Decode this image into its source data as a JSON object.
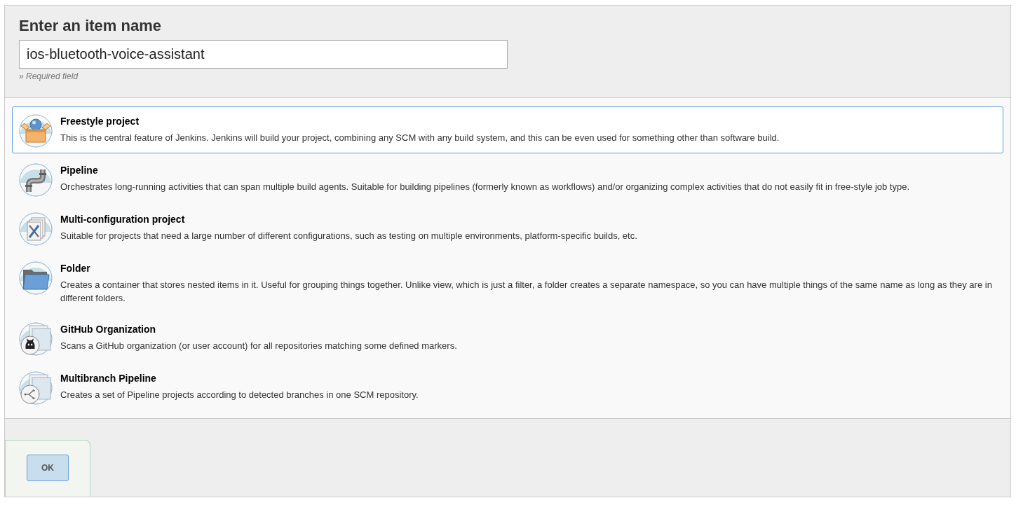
{
  "header": {
    "title": "Enter an item name",
    "name_field": {
      "value": "ios-bluetooth-voice-assistant"
    },
    "hint": "» Required field"
  },
  "item_types": [
    {
      "kind": "freestyle",
      "title": "Freestyle project",
      "description": "This is the central feature of Jenkins. Jenkins will build your project, combining any SCM with any build system, and this can be even used for something other than software build.",
      "selected": true
    },
    {
      "kind": "pipeline",
      "title": "Pipeline",
      "description": "Orchestrates long-running activities that can span multiple build agents. Suitable for building pipelines (formerly known as workflows) and/or organizing complex activities that do not easily fit in free-style job type.",
      "selected": false
    },
    {
      "kind": "multiconfig",
      "title": "Multi-configuration project",
      "description": "Suitable for projects that need a large number of different configurations, such as testing on multiple environments, platform-specific builds, etc.",
      "selected": false
    },
    {
      "kind": "folder",
      "title": "Folder",
      "description": "Creates a container that stores nested items in it. Useful for grouping things together. Unlike view, which is just a filter, a folder creates a separate namespace, so you can have multiple things of the same name as long as they are in different folders.",
      "selected": false
    },
    {
      "kind": "github",
      "title": "GitHub Organization",
      "description": "Scans a GitHub organization (or user account) for all repositories matching some defined markers.",
      "selected": false
    },
    {
      "kind": "multibranch",
      "title": "Multibranch Pipeline",
      "description": "Creates a set of Pipeline projects according to detected branches in one SCM repository.",
      "selected": false
    }
  ],
  "footer": {
    "ok_button": "OK"
  }
}
